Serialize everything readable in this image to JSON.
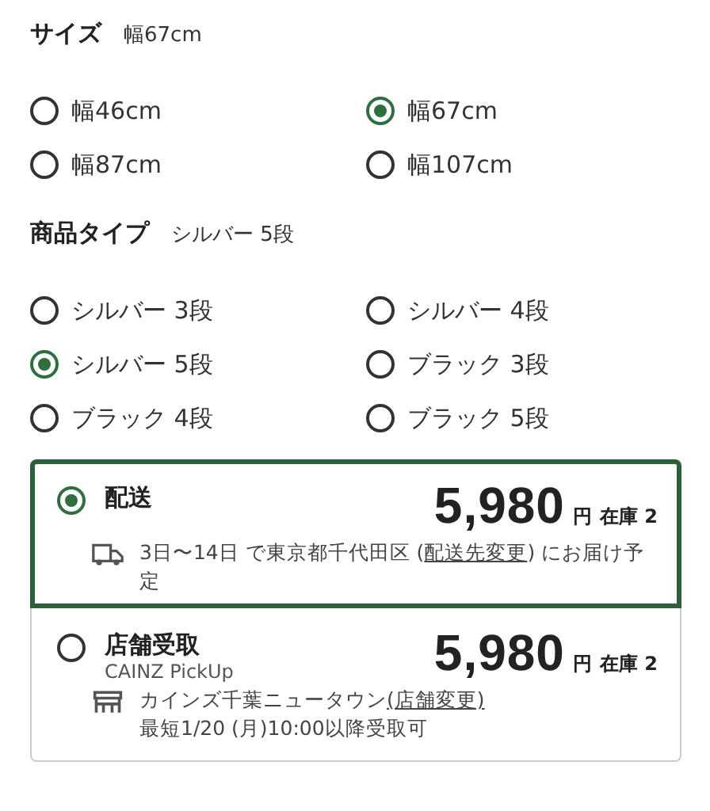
{
  "size": {
    "label": "サイズ",
    "value": "幅67cm",
    "options": [
      {
        "label": "幅46cm",
        "selected": false
      },
      {
        "label": "幅67cm",
        "selected": true
      },
      {
        "label": "幅87cm",
        "selected": false
      },
      {
        "label": "幅107cm",
        "selected": false
      }
    ]
  },
  "type": {
    "label": "商品タイプ",
    "value": "シルバー 5段",
    "options": [
      {
        "label": "シルバー 3段",
        "selected": false
      },
      {
        "label": "シルバー 4段",
        "selected": false
      },
      {
        "label": "シルバー 5段",
        "selected": true
      },
      {
        "label": "ブラック 3段",
        "selected": false
      },
      {
        "label": "ブラック 4段",
        "selected": false
      },
      {
        "label": "ブラック 5段",
        "selected": false
      }
    ]
  },
  "fulfillment": [
    {
      "kind": "delivery",
      "selected": true,
      "title": "配送",
      "price": "5,980",
      "currency": "円",
      "stock": "在庫 2",
      "before": "3日〜14日 で東京都千代田区 (",
      "link": "配送先変更",
      "after": ") にお届け予定"
    },
    {
      "kind": "store",
      "selected": false,
      "title": "店舗受取",
      "subtitle": "CAINZ PickUp",
      "price": "5,980",
      "currency": "円",
      "stock": "在庫 2",
      "store": "カインズ千葉ニュータウン",
      "link": "(店舗変更)",
      "note": "最短1/20 (月)10:00以降受取可"
    }
  ]
}
